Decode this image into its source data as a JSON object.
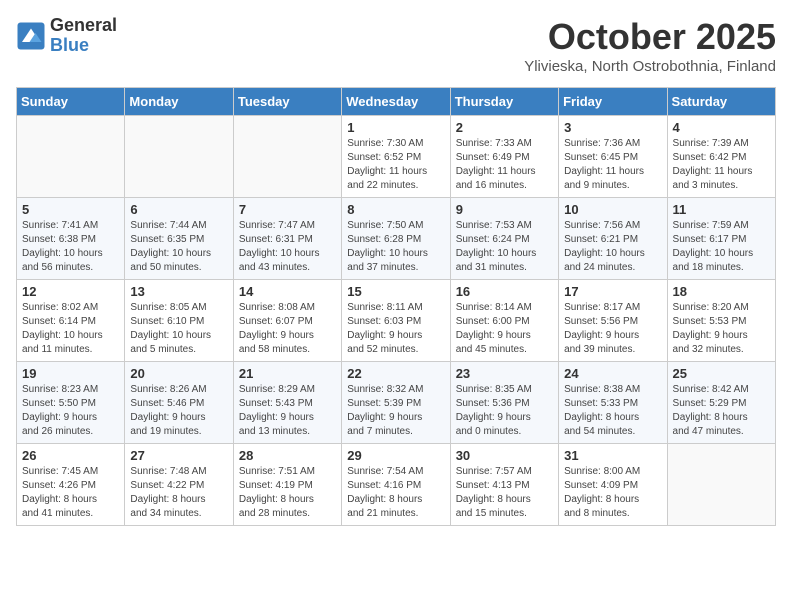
{
  "logo": {
    "general": "General",
    "blue": "Blue"
  },
  "title": "October 2025",
  "subtitle": "Ylivieska, North Ostrobothnia, Finland",
  "days_of_week": [
    "Sunday",
    "Monday",
    "Tuesday",
    "Wednesday",
    "Thursday",
    "Friday",
    "Saturday"
  ],
  "weeks": [
    [
      {
        "day": "",
        "info": ""
      },
      {
        "day": "",
        "info": ""
      },
      {
        "day": "",
        "info": ""
      },
      {
        "day": "1",
        "info": "Sunrise: 7:30 AM\nSunset: 6:52 PM\nDaylight: 11 hours\nand 22 minutes."
      },
      {
        "day": "2",
        "info": "Sunrise: 7:33 AM\nSunset: 6:49 PM\nDaylight: 11 hours\nand 16 minutes."
      },
      {
        "day": "3",
        "info": "Sunrise: 7:36 AM\nSunset: 6:45 PM\nDaylight: 11 hours\nand 9 minutes."
      },
      {
        "day": "4",
        "info": "Sunrise: 7:39 AM\nSunset: 6:42 PM\nDaylight: 11 hours\nand 3 minutes."
      }
    ],
    [
      {
        "day": "5",
        "info": "Sunrise: 7:41 AM\nSunset: 6:38 PM\nDaylight: 10 hours\nand 56 minutes."
      },
      {
        "day": "6",
        "info": "Sunrise: 7:44 AM\nSunset: 6:35 PM\nDaylight: 10 hours\nand 50 minutes."
      },
      {
        "day": "7",
        "info": "Sunrise: 7:47 AM\nSunset: 6:31 PM\nDaylight: 10 hours\nand 43 minutes."
      },
      {
        "day": "8",
        "info": "Sunrise: 7:50 AM\nSunset: 6:28 PM\nDaylight: 10 hours\nand 37 minutes."
      },
      {
        "day": "9",
        "info": "Sunrise: 7:53 AM\nSunset: 6:24 PM\nDaylight: 10 hours\nand 31 minutes."
      },
      {
        "day": "10",
        "info": "Sunrise: 7:56 AM\nSunset: 6:21 PM\nDaylight: 10 hours\nand 24 minutes."
      },
      {
        "day": "11",
        "info": "Sunrise: 7:59 AM\nSunset: 6:17 PM\nDaylight: 10 hours\nand 18 minutes."
      }
    ],
    [
      {
        "day": "12",
        "info": "Sunrise: 8:02 AM\nSunset: 6:14 PM\nDaylight: 10 hours\nand 11 minutes."
      },
      {
        "day": "13",
        "info": "Sunrise: 8:05 AM\nSunset: 6:10 PM\nDaylight: 10 hours\nand 5 minutes."
      },
      {
        "day": "14",
        "info": "Sunrise: 8:08 AM\nSunset: 6:07 PM\nDaylight: 9 hours\nand 58 minutes."
      },
      {
        "day": "15",
        "info": "Sunrise: 8:11 AM\nSunset: 6:03 PM\nDaylight: 9 hours\nand 52 minutes."
      },
      {
        "day": "16",
        "info": "Sunrise: 8:14 AM\nSunset: 6:00 PM\nDaylight: 9 hours\nand 45 minutes."
      },
      {
        "day": "17",
        "info": "Sunrise: 8:17 AM\nSunset: 5:56 PM\nDaylight: 9 hours\nand 39 minutes."
      },
      {
        "day": "18",
        "info": "Sunrise: 8:20 AM\nSunset: 5:53 PM\nDaylight: 9 hours\nand 32 minutes."
      }
    ],
    [
      {
        "day": "19",
        "info": "Sunrise: 8:23 AM\nSunset: 5:50 PM\nDaylight: 9 hours\nand 26 minutes."
      },
      {
        "day": "20",
        "info": "Sunrise: 8:26 AM\nSunset: 5:46 PM\nDaylight: 9 hours\nand 19 minutes."
      },
      {
        "day": "21",
        "info": "Sunrise: 8:29 AM\nSunset: 5:43 PM\nDaylight: 9 hours\nand 13 minutes."
      },
      {
        "day": "22",
        "info": "Sunrise: 8:32 AM\nSunset: 5:39 PM\nDaylight: 9 hours\nand 7 minutes."
      },
      {
        "day": "23",
        "info": "Sunrise: 8:35 AM\nSunset: 5:36 PM\nDaylight: 9 hours\nand 0 minutes."
      },
      {
        "day": "24",
        "info": "Sunrise: 8:38 AM\nSunset: 5:33 PM\nDaylight: 8 hours\nand 54 minutes."
      },
      {
        "day": "25",
        "info": "Sunrise: 8:42 AM\nSunset: 5:29 PM\nDaylight: 8 hours\nand 47 minutes."
      }
    ],
    [
      {
        "day": "26",
        "info": "Sunrise: 7:45 AM\nSunset: 4:26 PM\nDaylight: 8 hours\nand 41 minutes."
      },
      {
        "day": "27",
        "info": "Sunrise: 7:48 AM\nSunset: 4:22 PM\nDaylight: 8 hours\nand 34 minutes."
      },
      {
        "day": "28",
        "info": "Sunrise: 7:51 AM\nSunset: 4:19 PM\nDaylight: 8 hours\nand 28 minutes."
      },
      {
        "day": "29",
        "info": "Sunrise: 7:54 AM\nSunset: 4:16 PM\nDaylight: 8 hours\nand 21 minutes."
      },
      {
        "day": "30",
        "info": "Sunrise: 7:57 AM\nSunset: 4:13 PM\nDaylight: 8 hours\nand 15 minutes."
      },
      {
        "day": "31",
        "info": "Sunrise: 8:00 AM\nSunset: 4:09 PM\nDaylight: 8 hours\nand 8 minutes."
      },
      {
        "day": "",
        "info": ""
      }
    ]
  ]
}
